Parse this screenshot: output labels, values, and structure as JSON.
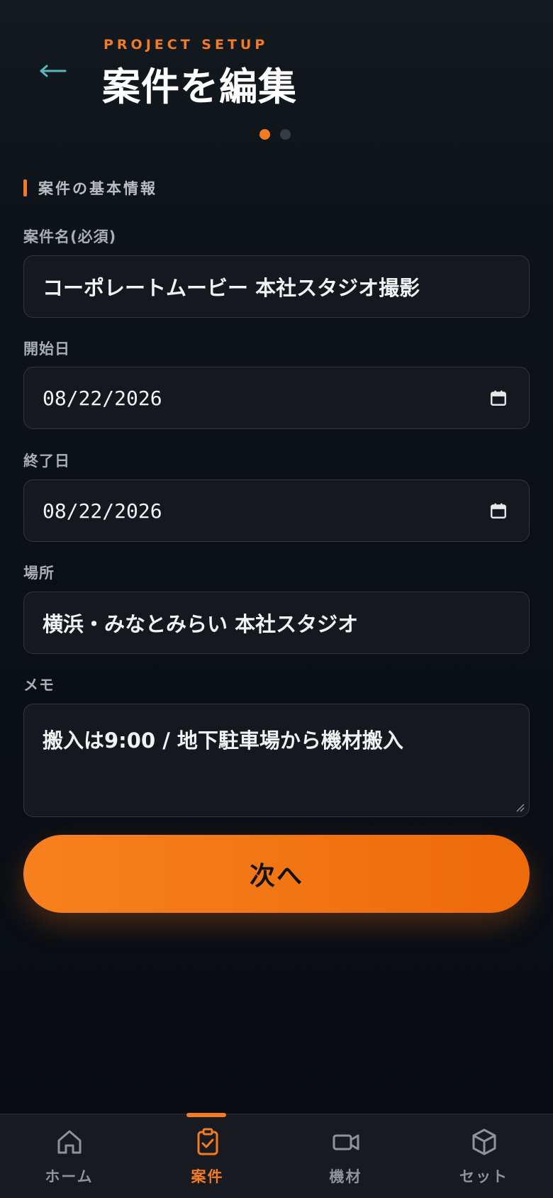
{
  "header": {
    "eyebrow": "PROJECT SETUP",
    "title": "案件を編集",
    "step_total": 2,
    "step_current": 1
  },
  "section": {
    "title": "案件の基本情報"
  },
  "fields": {
    "name": {
      "label": "案件名(必須)",
      "value": "コーポレートムービー 本社スタジオ撮影"
    },
    "start_date": {
      "label": "開始日",
      "value": "08/22/2026"
    },
    "end_date": {
      "label": "終了日",
      "value": "08/22/2026"
    },
    "location": {
      "label": "場所",
      "value": "横浜・みなとみらい 本社スタジオ"
    },
    "memo": {
      "label": "メモ",
      "value": "搬入は9:00 / 地下駐車場から機材搬入"
    }
  },
  "next_button": {
    "label": "次へ"
  },
  "tabs": [
    {
      "label": "ホーム",
      "icon": "home-icon",
      "active": false
    },
    {
      "label": "案件",
      "icon": "clipboard-check-icon",
      "active": true
    },
    {
      "label": "機材",
      "icon": "video-camera-icon",
      "active": false
    },
    {
      "label": "セット",
      "icon": "box-icon",
      "active": false
    }
  ],
  "colors": {
    "accent": "#f47b20",
    "background": "#0a0f15",
    "field_bg": "#15191f",
    "muted_text": "#8d939a"
  }
}
